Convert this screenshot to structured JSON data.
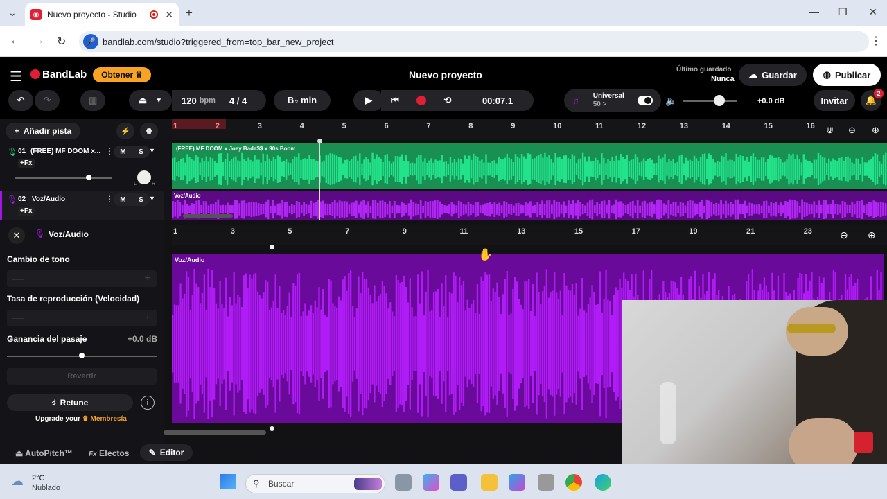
{
  "browser": {
    "tab_title": "Nuevo proyecto - Studio",
    "url": "bandlab.com/studio?triggered_from=top_bar_new_project"
  },
  "header": {
    "logo": "BandLab",
    "get_btn": "Obtener",
    "project_title": "Nuevo proyecto",
    "last_saved_label": "Último guardado",
    "last_saved_value": "Nunca",
    "save_btn": "Guardar",
    "publish_btn": "Publicar"
  },
  "toolbar": {
    "bpm_value": "120",
    "bpm_unit": "bpm",
    "time_sig": "4 / 4",
    "key": "B♭ min",
    "time": "00:07.1",
    "preset_name": "Universal",
    "preset_sub": "50 >",
    "master_db": "+0.0 dB",
    "invite_btn": "Invitar",
    "notif_count": "2"
  },
  "tracks": {
    "add_track": "Añadir pista",
    "ruler": [
      "1",
      "2",
      "3",
      "4",
      "5",
      "6",
      "7",
      "8",
      "9",
      "10",
      "11",
      "12",
      "13",
      "14",
      "15",
      "16"
    ],
    "items": [
      {
        "num": "01",
        "name": "(FREE) MF DOOM x...",
        "fx": "+Fx",
        "clip": "(FREE) MF DOOM x Joey Bada$$ x 90s Boom"
      },
      {
        "num": "02",
        "name": "Voz/Audio",
        "fx": "+Fx",
        "clip": "Voz/Audio"
      }
    ],
    "m": "M",
    "s": "S",
    "pan_l": "L",
    "pan_r": "R"
  },
  "editor": {
    "title": "Voz/Audio",
    "pitch_label": "Cambio de tono",
    "rate_label": "Tasa de reproducción (Velocidad)",
    "gain_label": "Ganancia del pasaje",
    "gain_value": "+0.0 dB",
    "revert_btn": "Revertir",
    "retune_btn": "Retune",
    "upgrade_text": "Upgrade your",
    "membership": "Membresía",
    "clip_label": "Voz/Audio",
    "ruler": [
      "1",
      "3",
      "5",
      "7",
      "9",
      "11",
      "13",
      "15",
      "17",
      "19",
      "21",
      "23"
    ],
    "tabs": [
      "AutoPitch™",
      "Efectos",
      "Editor"
    ]
  },
  "taskbar": {
    "temp": "2°C",
    "weather": "Nublado",
    "search": "Buscar"
  },
  "colors": {
    "accent_orange": "#f7a325",
    "track1": "#1fd37a",
    "track2": "#a317e6",
    "record": "#e01e35"
  }
}
